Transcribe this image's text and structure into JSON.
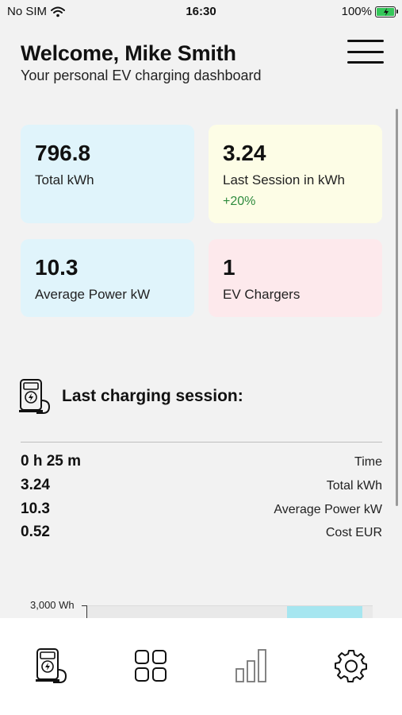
{
  "status": {
    "carrier": "No SIM",
    "time": "16:30",
    "battery": "100%"
  },
  "header": {
    "title": "Welcome, Mike Smith",
    "subtitle": "Your personal EV charging dashboard"
  },
  "stats": [
    {
      "value": "796.8",
      "label": "Total kWh",
      "color": "#e0f4fb"
    },
    {
      "value": "3.24",
      "label": "Last Session in kWh",
      "delta": "+20%",
      "color": "#fdfde6"
    },
    {
      "value": "10.3",
      "label": "Average Power kW",
      "color": "#e0f4fb"
    },
    {
      "value": "1",
      "label": "EV Chargers",
      "color": "#fde9ec"
    }
  ],
  "last_session": {
    "title": "Last charging session:",
    "rows": [
      {
        "value": "0 h 25 m",
        "label": "Time"
      },
      {
        "value": "3.24",
        "label": "Total kWh"
      },
      {
        "value": "10.3",
        "label": "Average Power kW"
      },
      {
        "value": "0.52",
        "label": "Cost EUR"
      }
    ]
  },
  "chart": {
    "axis_label": "3,000 Wh"
  },
  "tabs": [
    {
      "icon": "ev-charger-icon"
    },
    {
      "icon": "grid-icon"
    },
    {
      "icon": "bar-chart-icon"
    },
    {
      "icon": "gear-icon"
    }
  ],
  "colors": {
    "positive": "#2e8b3e",
    "bar": "#a6e6f0",
    "battery": "#34c759"
  }
}
